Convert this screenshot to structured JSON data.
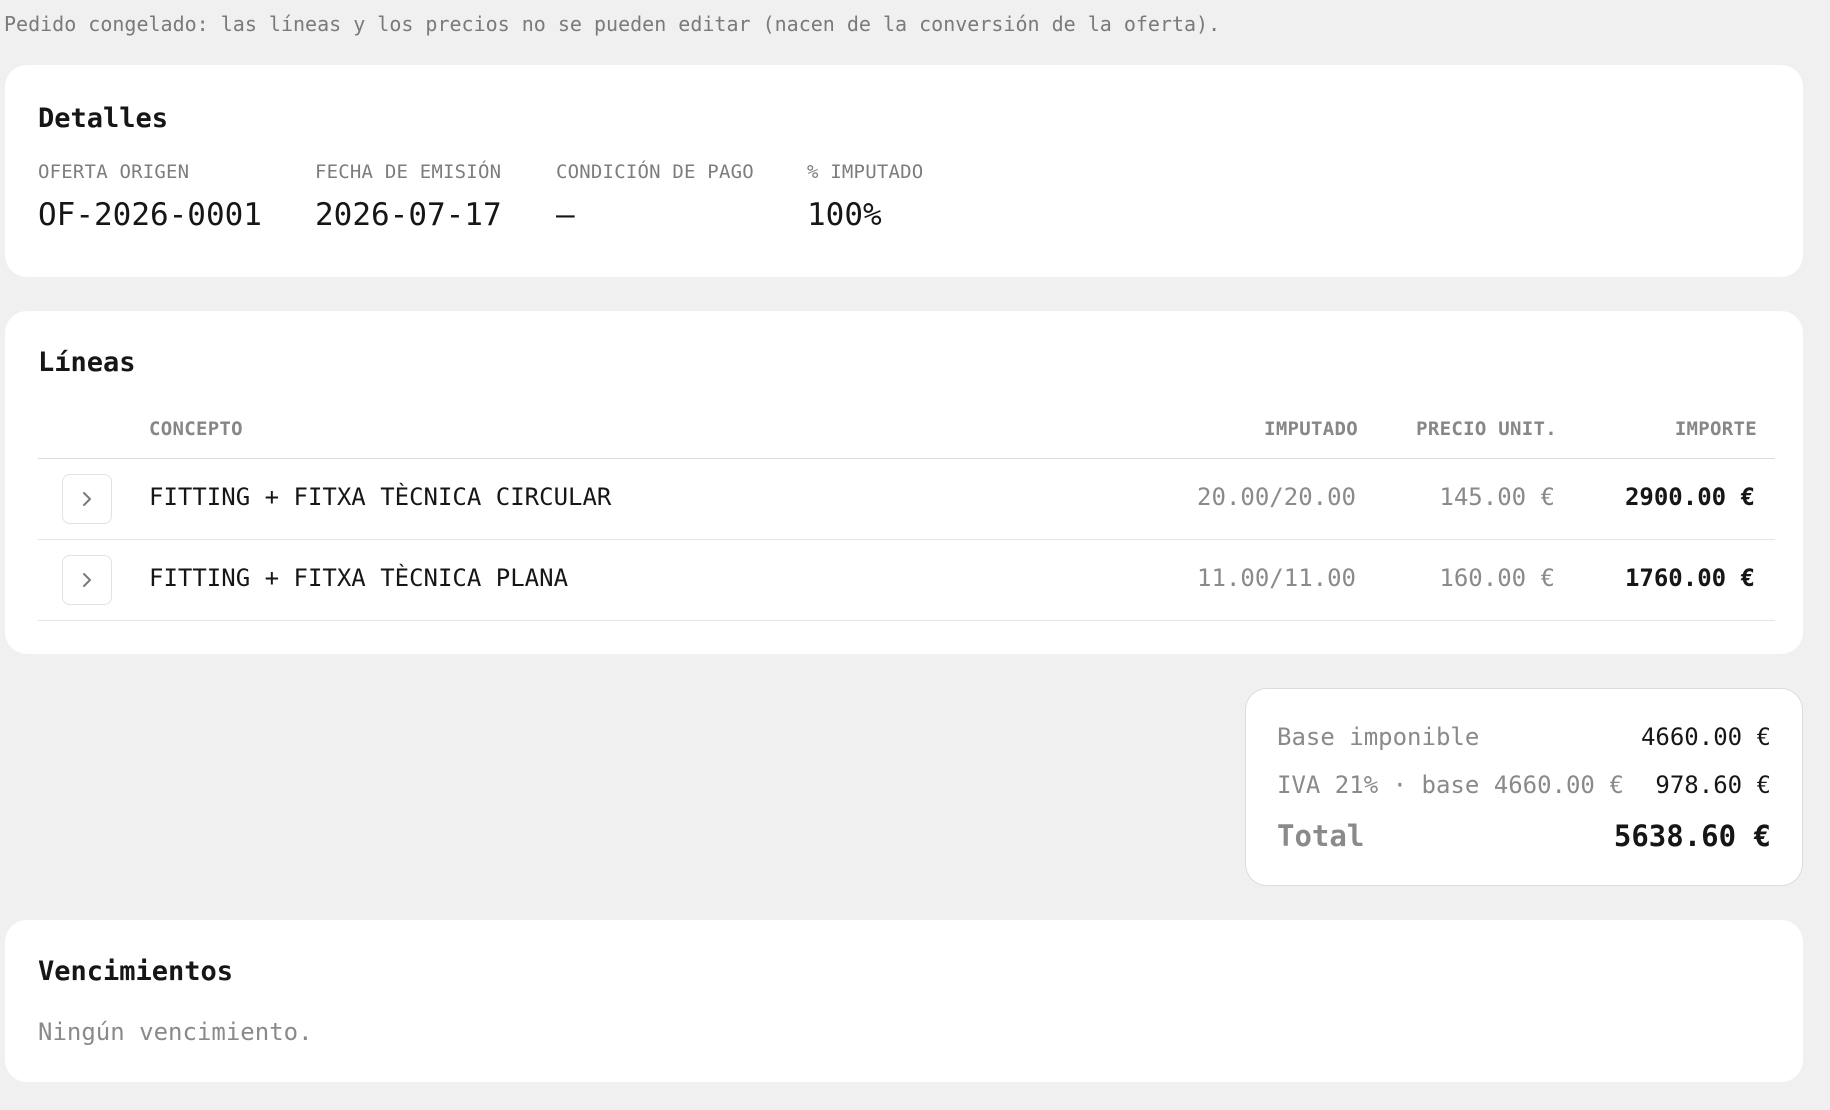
{
  "notice": "Pedido congelado: las líneas y los precios no se pueden editar (nacen de la conversión de la oferta).",
  "detalles": {
    "title": "Detalles",
    "fields": [
      {
        "label": "OFERTA ORIGEN",
        "value": "OF-2026-0001"
      },
      {
        "label": "FECHA DE EMISIÓN",
        "value": "2026-07-17"
      },
      {
        "label": "CONDICIÓN DE PAGO",
        "value": "—"
      },
      {
        "label": "% IMPUTADO",
        "value": "100%"
      }
    ]
  },
  "lineas": {
    "title": "Líneas",
    "columns": {
      "concepto": "CONCEPTO",
      "imputado": "IMPUTADO",
      "precio": "PRECIO UNIT.",
      "importe": "IMPORTE"
    },
    "expand_icon": "chevron-right-icon",
    "rows": [
      {
        "concepto": "FITTING + FITXA TÈCNICA CIRCULAR",
        "imputado": "20.00/20.00",
        "precio": "145.00 €",
        "importe": "2900.00 €"
      },
      {
        "concepto": "FITTING + FITXA TÈCNICA PLANA",
        "imputado": "11.00/11.00",
        "precio": "160.00 €",
        "importe": "1760.00 €"
      }
    ]
  },
  "totals": {
    "base_label": "Base imponible",
    "base_value": "4660.00 €",
    "iva_label": "IVA 21% · base 4660.00 €",
    "iva_value": "978.60 €",
    "total_label": "Total",
    "total_value": "5638.60 €"
  },
  "vencimientos": {
    "title": "Vencimientos",
    "empty": "Ningún vencimiento."
  }
}
